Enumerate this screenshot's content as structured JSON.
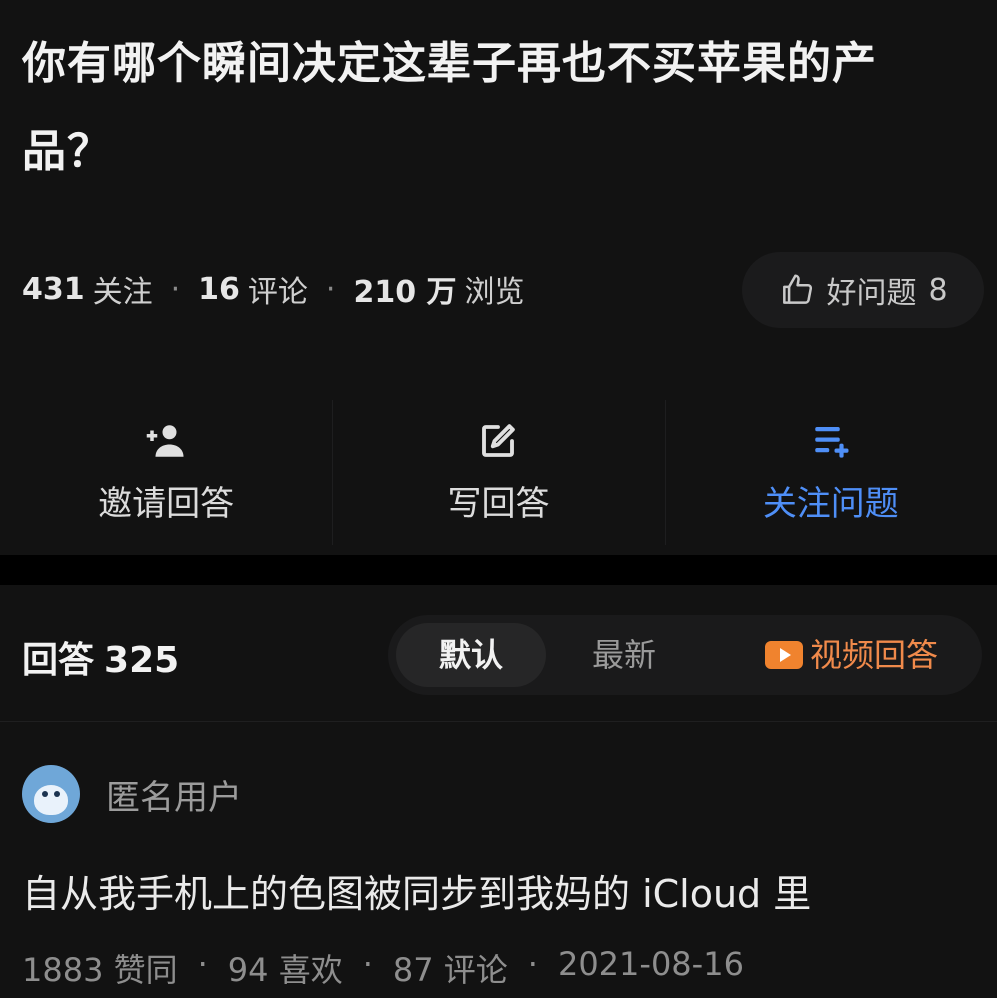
{
  "question": {
    "title": "你有哪个瞬间决定这辈子再也不买苹果的产品？",
    "stats": {
      "follows_num": "431",
      "follows_label": "关注",
      "comments_num": "16",
      "comments_label": "评论",
      "views_num": "210 万",
      "views_label": "浏览"
    },
    "good_question": {
      "label": "好问题",
      "count": "8"
    },
    "actions": {
      "invite": "邀请回答",
      "write": "写回答",
      "follow": "关注问题"
    }
  },
  "answers": {
    "header_label": "回答",
    "count": "325",
    "sort": {
      "default": "默认",
      "latest": "最新",
      "video": "视频回答"
    },
    "item": {
      "author": "匿名用户",
      "text": "自从我手机上的色图被同步到我妈的 iCloud 里",
      "meta": {
        "likes": "1883 赞同",
        "favorites": "94 喜欢",
        "comments": "87 评论",
        "date": "2021-08-16"
      }
    }
  },
  "colors": {
    "accent_blue": "#4f8ff7",
    "video_orange": "#f08a4b"
  },
  "icons": {
    "good_question": "thumbs-up-icon",
    "invite": "add-person-icon",
    "write": "edit-icon",
    "follow": "add-list-icon",
    "video": "play-video-icon"
  }
}
